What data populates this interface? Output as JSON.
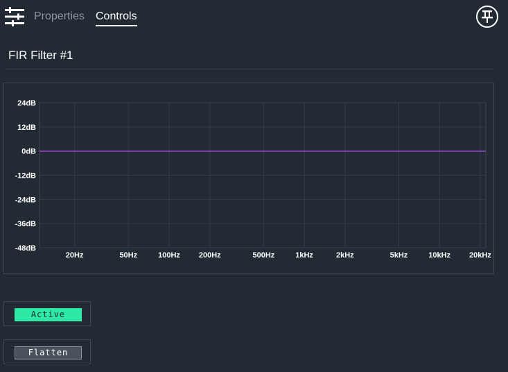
{
  "header": {
    "app_icon": "sliders-icon",
    "tabs": [
      {
        "label": "Properties",
        "active": false
      },
      {
        "label": "Controls",
        "active": true
      }
    ],
    "pin_icon": "pin-icon"
  },
  "panel": {
    "title": "FIR Filter #1"
  },
  "chart_data": {
    "type": "line",
    "title": "",
    "xlabel": "",
    "ylabel": "",
    "x_scale": "log",
    "xlim": [
      11,
      22000
    ],
    "ylim": [
      -48,
      24
    ],
    "y_ticks": [
      {
        "value": 24,
        "label": "24dB"
      },
      {
        "value": 12,
        "label": "12dB"
      },
      {
        "value": 0,
        "label": "0dB"
      },
      {
        "value": -12,
        "label": "-12dB"
      },
      {
        "value": -24,
        "label": "-24dB"
      },
      {
        "value": -36,
        "label": "-36dB"
      },
      {
        "value": -48,
        "label": "-48dB"
      }
    ],
    "x_ticks": [
      {
        "value": 20,
        "label": "20Hz"
      },
      {
        "value": 50,
        "label": "50Hz"
      },
      {
        "value": 100,
        "label": "100Hz"
      },
      {
        "value": 200,
        "label": "200Hz"
      },
      {
        "value": 500,
        "label": "500Hz"
      },
      {
        "value": 1000,
        "label": "1kHz"
      },
      {
        "value": 2000,
        "label": "2kHz"
      },
      {
        "value": 5000,
        "label": "5kHz"
      },
      {
        "value": 10000,
        "label": "10kHz"
      },
      {
        "value": 20000,
        "label": "20kHz"
      }
    ],
    "grid": true,
    "series": [
      {
        "x": [
          11,
          20,
          100,
          1000,
          10000,
          22000
        ],
        "y": [
          0,
          0,
          0,
          0,
          0,
          0
        ],
        "color": "#a64fd4"
      }
    ]
  },
  "controls": {
    "active_label": "Active",
    "flatten_label": "Flatten"
  },
  "colors": {
    "background": "#222a33",
    "accent_active": "#2ee8a6",
    "curve": "#a64fd4",
    "grid": "#353e47"
  }
}
